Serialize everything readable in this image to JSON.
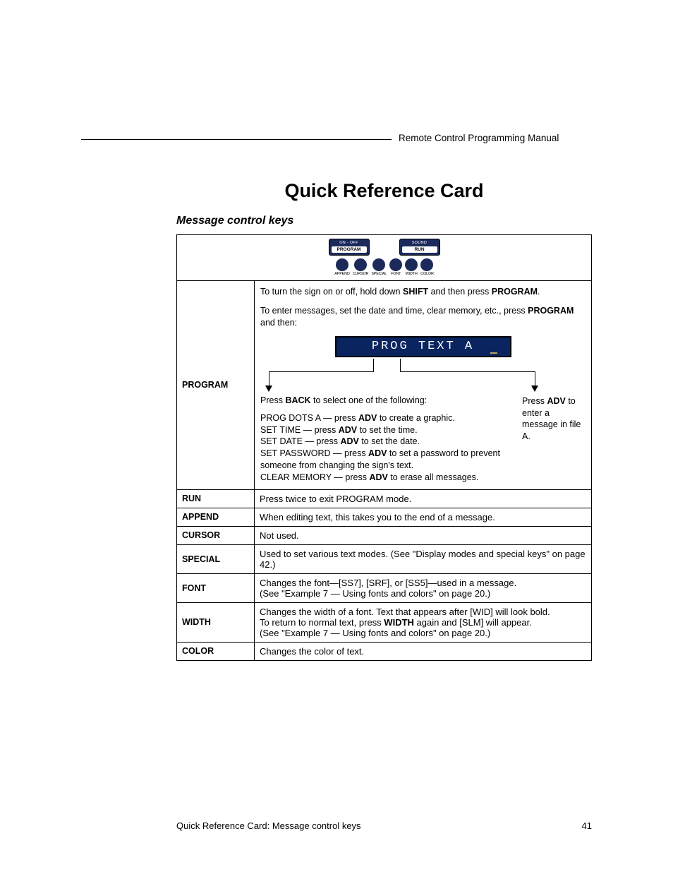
{
  "header": {
    "doc_title": "Remote Control Programming Manual"
  },
  "title": "Quick Reference Card",
  "section": "Message control keys",
  "remote": {
    "btn1_top": "ON - OFF",
    "btn1_bot": "PROGRAM",
    "btn2_top": "SOUND",
    "btn2_bot": "RUN",
    "dots": [
      "APPEND",
      "CURSOR",
      "SPECIAL",
      "FONT",
      "WIDTH",
      "COLOR"
    ]
  },
  "program": {
    "key": "PROGRAM",
    "line1_pre": "To turn the sign on or off, hold down ",
    "line1_k1": "SHIFT",
    "line1_mid": " and then press ",
    "line1_k2": "PROGRAM",
    "line1_post": ".",
    "line2_pre": "To enter messages, set the date and time, clear memory, etc., press ",
    "line2_k": "PROGRAM",
    "line2_post": " and then:",
    "lcd": "PROG TEXT A",
    "back_pre": "Press ",
    "back_k": "BACK",
    "back_post": " to select one of the following:",
    "adv_pre": "Press ",
    "adv_k": "ADV",
    "adv_post": " to enter a message in file A.",
    "s1_pre": "PROG DOTS A — press ",
    "s1_k": "ADV",
    "s1_post": " to create a graphic.",
    "s2_pre": "SET TIME — press ",
    "s2_k": "ADV",
    "s2_post": " to set the time.",
    "s3_pre": "SET DATE — press ",
    "s3_k": "ADV",
    "s3_post": " to set the date.",
    "s4_pre": "SET PASSWORD — press ",
    "s4_k": "ADV",
    "s4_post": " to set a password to prevent someone from changing the sign's text.",
    "s5_pre": "CLEAR MEMORY — press ",
    "s5_k": "ADV",
    "s5_post": " to erase all messages."
  },
  "rows": {
    "run": {
      "key": "RUN",
      "desc": "Press twice to exit PROGRAM mode."
    },
    "append": {
      "key": "APPEND",
      "desc": "When editing text, this takes you to the end of a message."
    },
    "cursor": {
      "key": "CURSOR",
      "desc": "Not used."
    },
    "special": {
      "key": "SPECIAL",
      "desc": "Used to set various text modes. (See \"Display modes and special keys\" on page 42.)"
    },
    "font": {
      "key": "FONT",
      "desc": "Changes the font—[SS7], [SRF], or [SS5]—used in a message.\n(See \"Example 7 — Using fonts and colors\" on page 20.)"
    },
    "width": {
      "key": "WIDTH",
      "pre": "Changes the width of a font. Text that appears after [WID] will look bold.\nTo return to normal text, press ",
      "k": "WIDTH",
      "post": " again and [SLM] will appear.\n(See \"Example 7 — Using fonts and colors\" on page 20.)"
    },
    "color": {
      "key": "COLOR",
      "desc": "Changes the color of text."
    }
  },
  "footer": {
    "left": "Quick Reference Card: Message control keys",
    "page": "41"
  }
}
